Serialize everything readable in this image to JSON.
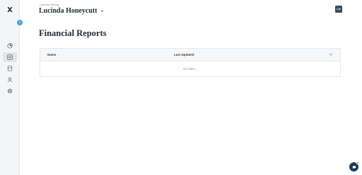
{
  "sidebar": {
    "logo_text": "X",
    "expand_badge": "›",
    "items": [
      {
        "icon": "pie-chart-icon",
        "active": false
      },
      {
        "icon": "reports-icon",
        "active": true
      },
      {
        "icon": "documents-icon",
        "active": false
      },
      {
        "icon": "users-icon",
        "active": false
      },
      {
        "icon": "settings-icon",
        "active": false
      }
    ]
  },
  "header": {
    "viewing_label": "Currently Viewing",
    "account_name": "Lucinda Honeycutt",
    "user_initials": "LH"
  },
  "page": {
    "title": "Financial Reports"
  },
  "table": {
    "columns": [
      {
        "label": "Name",
        "sortable": true
      },
      {
        "label": "Last Updated",
        "sortable": false
      }
    ],
    "rows": [],
    "empty_text": "No data..."
  },
  "colors": {
    "accent": "#4aa3df",
    "avatar_bg": "#3b4a5c",
    "chat_bg": "#1f3b5a",
    "notification": "#e0413a"
  }
}
